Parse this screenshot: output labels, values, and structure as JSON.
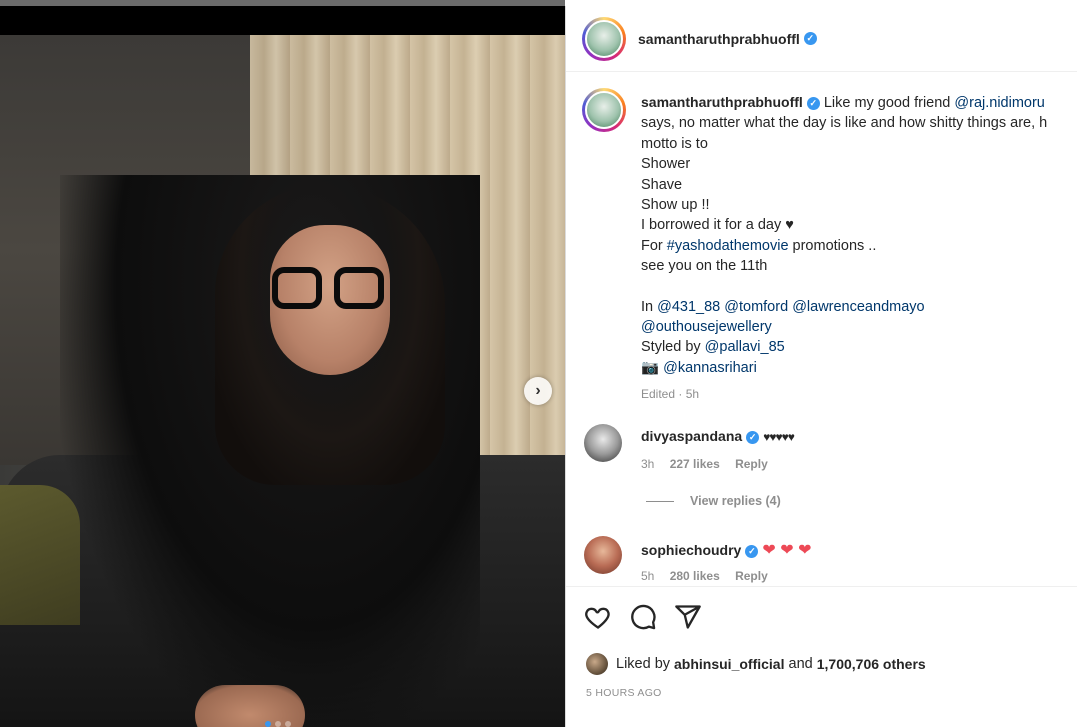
{
  "post": {
    "username": "samantharuthprabhuoffl",
    "verified_icon": "verified-badge-icon"
  },
  "caption": {
    "username": "samantharuthprabhuoffl",
    "line1_text": "Like my good friend ",
    "line1_mention": "@raj.nidimoru",
    "line2": "says, no matter what the day is like and how shitty things are, h",
    "line3": "motto is to",
    "line4": "Shower",
    "line5": "Shave",
    "line6": "Show up !!",
    "line7": "I borrowed it for a day ♥",
    "line8_prefix": "For ",
    "line8_tag": "#yashodathemovie",
    "line8_suffix": " promotions ..",
    "line9": "see you on the 11th",
    "in_prefix": "In ",
    "in_mentions": [
      "@431_88",
      "@tomford",
      "@lawrenceandmayo"
    ],
    "mention_outhouse": "@outhousejewellery",
    "styled_prefix": "Styled by ",
    "styled_mention": "@pallavi_85",
    "camera_emoji": "📷",
    "camera_mention": "@kannasrihari",
    "meta": "Edited · 5h"
  },
  "comments": [
    {
      "username": "divyaspandana",
      "text": "♥♥♥♥♥",
      "time": "3h",
      "likes": "227 likes",
      "reply": "Reply"
    },
    {
      "username": "sophiechoudry",
      "text": "❤ ❤ ❤",
      "time": "5h",
      "likes": "280 likes",
      "reply": "Reply"
    }
  ],
  "view_replies": "View replies (4)",
  "likes": {
    "prefix": "Liked by ",
    "user": "abhinsui_official",
    "middle": " and ",
    "count": "1,700,706 others"
  },
  "timestamp": "5 HOURS AGO",
  "carousel": {
    "next_glyph": "›",
    "total_slides": 3,
    "active_slide": 1
  },
  "colors": {
    "link": "#00376b",
    "verified": "#3897f0",
    "muted": "#8e8e8e",
    "heart_red": "#ed4956"
  }
}
